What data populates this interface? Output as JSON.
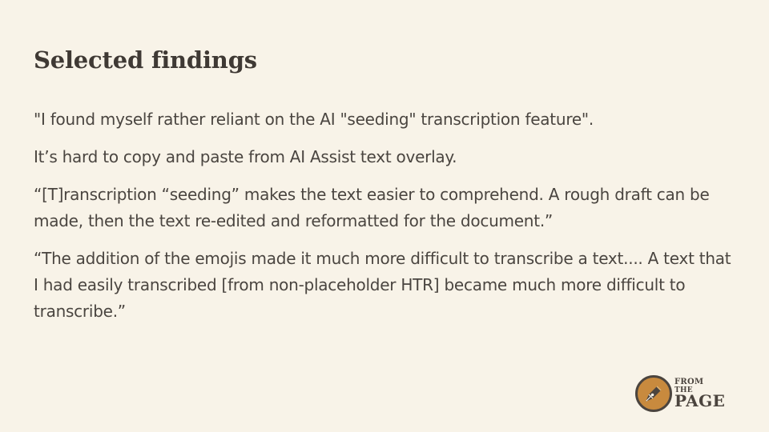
{
  "slide": {
    "title": "Selected findings"
  },
  "findings": [
    "\"I found myself rather reliant on the AI \"seeding\" transcription feature\".",
    "It’s hard to copy and paste from AI Assist text overlay.",
    "“[T]ranscription “seeding” makes the text easier to comprehend. A rough draft can be made, then the text re-edited and reformatted for the document.”",
    "“The addition of the emojis made it much more difficult to transcribe a text.... A text that I had easily transcribed [from non-placeholder HTR] became much more difficult to transcribe.”"
  ],
  "logo": {
    "line1": "FROM",
    "line2": "THE",
    "line3": "PAGE",
    "icon": "quill-pen-nib-icon",
    "colors": {
      "ring": "#4b443e",
      "fill": "#c88a3e",
      "pen": "#4b443e"
    }
  },
  "colors": {
    "background": "#f8f3e8",
    "title": "#3f3934",
    "text": "#4a4540"
  }
}
